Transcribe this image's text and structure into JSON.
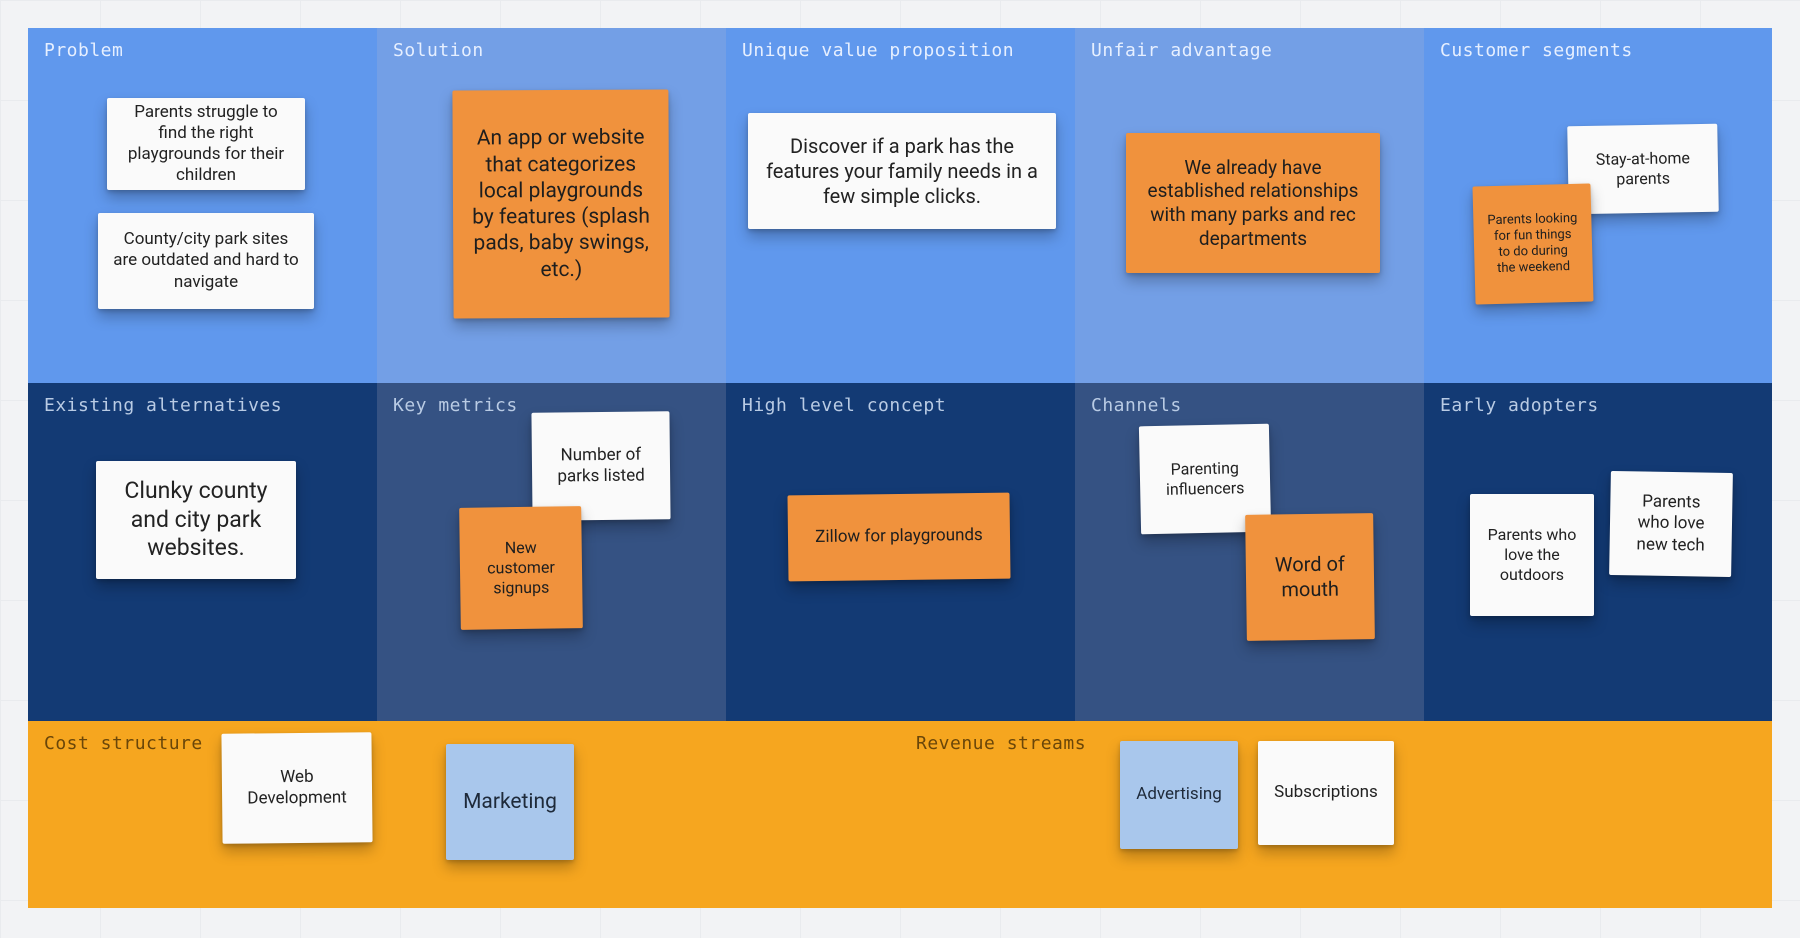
{
  "cells": {
    "problem": {
      "title": "Problem"
    },
    "solution": {
      "title": "Solution"
    },
    "uvp": {
      "title": "Unique value proposition"
    },
    "advantage": {
      "title": "Unfair advantage"
    },
    "segments": {
      "title": "Customer segments"
    },
    "alternatives": {
      "title": "Existing alternatives"
    },
    "metrics": {
      "title": "Key metrics"
    },
    "concept": {
      "title": "High level concept"
    },
    "channels": {
      "title": "Channels"
    },
    "adopters": {
      "title": "Early adopters"
    },
    "cost": {
      "title": "Cost structure"
    },
    "revenue": {
      "title": "Revenue streams"
    }
  },
  "stickies": {
    "problem1": "Parents struggle to find the right playgrounds for their children",
    "problem2": "County/city park sites are outdated and hard to navigate",
    "solution1": "An app or website that categorizes local playgrounds by features (splash pads, baby swings, etc.)",
    "uvp1": "Discover if a park has the features your family needs in a few simple clicks.",
    "advantage1": "We already have established relationships with many parks and rec departments",
    "segments1": "Stay-at-home parents",
    "segments2": "Parents looking for fun things to do during the weekend",
    "alternatives1": "Clunky county and city park websites.",
    "metrics1": "Number of parks listed",
    "metrics2": "New customer signups",
    "concept1": "Zillow for playgrounds",
    "channels1": "Parenting influencers",
    "channels2": "Word of mouth",
    "adopters1": "Parents who love the outdoors",
    "adopters2": "Parents who love new tech",
    "cost1": "Web Development",
    "cost2": "Marketing",
    "revenue1": "Advertising",
    "revenue2": "Subscriptions"
  }
}
